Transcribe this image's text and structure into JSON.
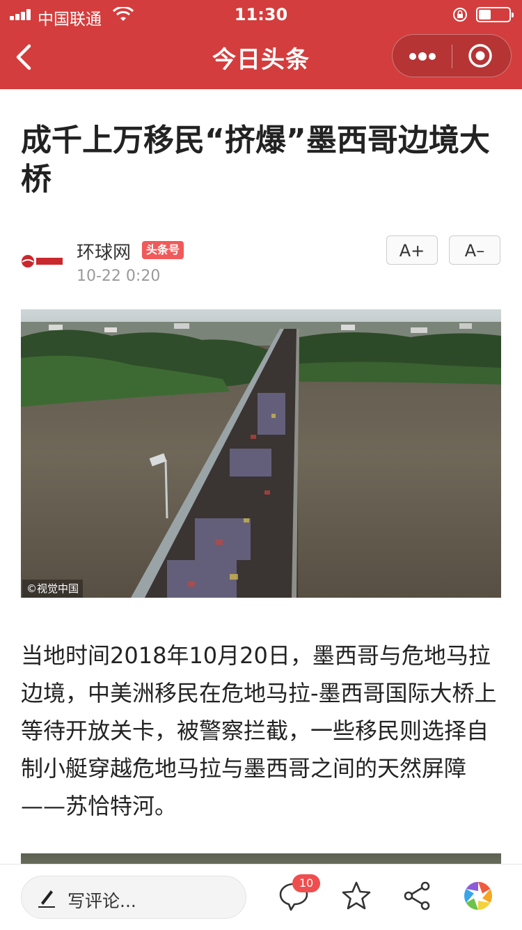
{
  "status_bar": {
    "carrier": "中国联通",
    "time": "11:30",
    "battery_level": 0.4
  },
  "nav": {
    "title": "今日头条"
  },
  "article": {
    "title": "成千上万移民“挤爆”墨西哥边境大桥",
    "source": {
      "name": "环球网",
      "badge": "头条号",
      "time": "10-22 0:20",
      "logo_text": "环球网"
    },
    "font_controls": {
      "increase": "A+",
      "decrease": "A–"
    },
    "image_watermark": "©视觉中国",
    "paragraph": "当地时间2018年10月20日，墨西哥与危地马拉边境，中美洲移民在危地马拉-墨西哥国际大桥上等待开放关卡，被警察拦截，一些移民则选择自制小艇穿越危地马拉与墨西哥之间的天然屏障——苏恰特河。"
  },
  "bottom_bar": {
    "comment_placeholder": "写评论...",
    "comment_count": "10"
  },
  "colors": {
    "header": "#d43d3d",
    "badge": "#f15a5a",
    "comment_badge": "#f04e4e"
  }
}
